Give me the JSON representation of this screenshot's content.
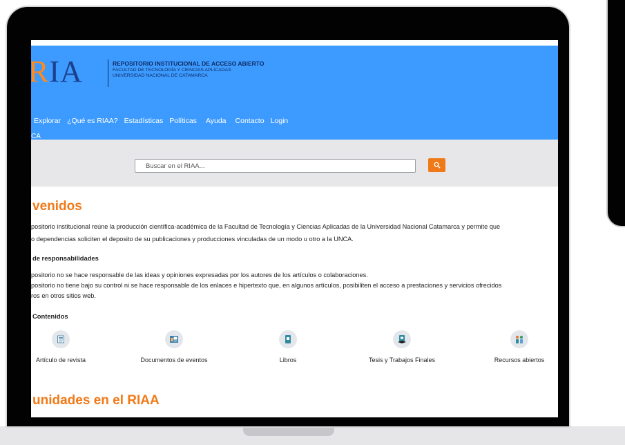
{
  "site": {
    "logo_left": "R",
    "logo_right": "IA",
    "title": "REPOSITORIO INSTITUCIONAL DE ACCESO ABIERTO",
    "subtitle_1": "FACULTAD DE TECNOLOGÍA Y CIENCIAS APLICADAS",
    "subtitle_2": "UNIVERSIDAD NACIONAL DE CATAMARCA"
  },
  "nav": {
    "items": [
      "Explorar",
      "¿Qué es RIAA?",
      "Estadísticas",
      "Políticas",
      "Ayuda",
      "Contacto",
      "Login"
    ],
    "breadcrumb": "CA"
  },
  "search": {
    "placeholder": "Buscar en el RIAA..."
  },
  "content": {
    "welcome_title": "venidos",
    "intro_line1": "positorio institucional reúne la producción científica-académica de la Facultad de Tecnología y Ciencias Aplicadas de la Universidad Nacional Catamarca y permite que",
    "intro_line2": "o dependencias soliciten el deposito de su publicaciones y producciones vinculadas de un modo u otro a la UNCA.",
    "resp_title": "de responsabilidades",
    "resp_line1": "positorio no se hace responsable de las ideas y opiniones expresadas por los autores de los artículos o colaboraciones.",
    "resp_line2": "positorio no tiene bajo su control ni se hace responsable de los enlaces e hipertexto que, en algunos artículos, posibiliten el acceso a prestaciones y servicios ofrecidos",
    "resp_line3": "ros en otros sitios web.",
    "contents_title": "Contenidos",
    "categories": [
      {
        "label": "Artículo de revista",
        "icon": "article-icon"
      },
      {
        "label": "Documentos de eventos",
        "icon": "event-documents-icon"
      },
      {
        "label": "Libros",
        "icon": "book-icon"
      },
      {
        "label": "Tesis y Trabajos Finales",
        "icon": "thesis-icon"
      },
      {
        "label": "Recursos abiertos",
        "icon": "open-resources-icon"
      }
    ],
    "communities_title": "unidades en el RIAA"
  },
  "colors": {
    "header_blue": "#3d9bff",
    "accent_orange": "#f07a18"
  }
}
